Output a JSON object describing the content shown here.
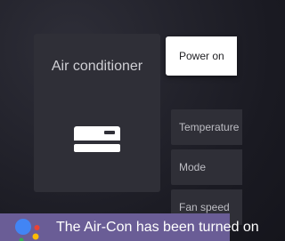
{
  "device": {
    "title": "Air conditioner",
    "icon": "air-conditioner-icon"
  },
  "controls": [
    {
      "label": "Power on",
      "selected": true
    },
    {
      "label": "Temperature",
      "selected": false
    },
    {
      "label": "Mode",
      "selected": false
    },
    {
      "label": "Fan speed",
      "selected": false
    }
  ],
  "assistant": {
    "icon": "google-assistant-icon",
    "message": "The Air-Con has been turned on",
    "colors": {
      "bar": "#6a5d96",
      "dot_blue": "#4285f4",
      "dot_red": "#ea4335",
      "dot_yellow": "#fbbc05",
      "dot_green": "#34a853"
    }
  }
}
